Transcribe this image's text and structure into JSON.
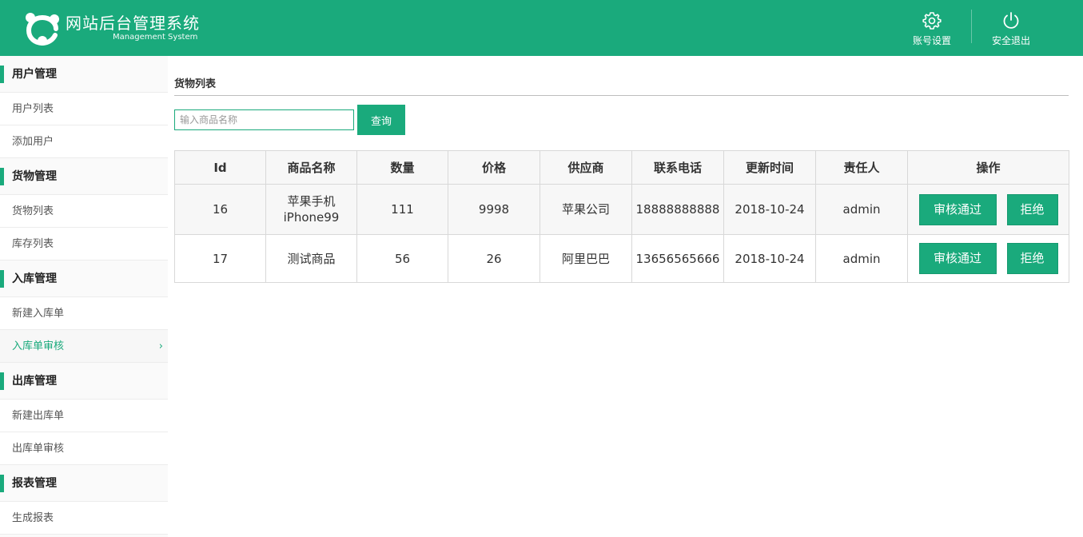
{
  "header": {
    "title": "网站后台管理系统",
    "subtitle": "Management System",
    "settings_label": "账号设置",
    "logout_label": "安全退出",
    "accent_color": "#1aaa7c"
  },
  "sidebar": {
    "groups": [
      {
        "label": "用户管理",
        "items": [
          {
            "label": "用户列表"
          },
          {
            "label": "添加用户"
          }
        ]
      },
      {
        "label": "货物管理",
        "items": [
          {
            "label": "货物列表"
          },
          {
            "label": "库存列表"
          }
        ]
      },
      {
        "label": "入库管理",
        "items": [
          {
            "label": "新建入库单"
          },
          {
            "label": "入库单审核"
          }
        ]
      },
      {
        "label": "出库管理",
        "items": [
          {
            "label": "新建出库单"
          },
          {
            "label": "出库单审核"
          }
        ]
      },
      {
        "label": "报表管理",
        "items": [
          {
            "label": "生成报表"
          }
        ]
      }
    ],
    "active_item": "入库单审核"
  },
  "main": {
    "title": "货物列表",
    "search": {
      "placeholder": "输入商品名称",
      "value": "",
      "button_label": "查询"
    },
    "table": {
      "columns": [
        "Id",
        "商品名称",
        "数量",
        "价格",
        "供应商",
        "联系电话",
        "更新时间",
        "责任人",
        "操作"
      ],
      "rows": [
        {
          "id": "16",
          "name_line1": "苹果手机",
          "name_line2": "iPhone99",
          "quantity": "111",
          "price": "9998",
          "supplier": "苹果公司",
          "phone": "18888888888",
          "updated": "2018-10-24",
          "owner": "admin"
        },
        {
          "id": "17",
          "name_line1": "测试商品",
          "name_line2": "",
          "quantity": "56",
          "price": "26",
          "supplier": "阿里巴巴",
          "phone": "13656565666",
          "updated": "2018-10-24",
          "owner": "admin"
        }
      ],
      "approve_label": "审核通过",
      "reject_label": "拒绝"
    }
  }
}
